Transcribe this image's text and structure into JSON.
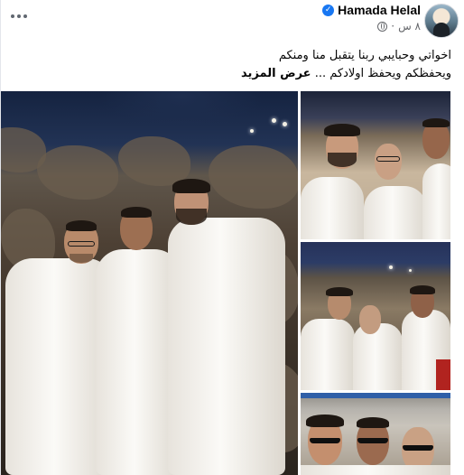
{
  "post": {
    "author": {
      "name": "Hamada Helal",
      "verified": true,
      "avatar_icon": "profile-avatar"
    },
    "meta": {
      "time": "٨ س",
      "audience_icon": "globe-icon"
    },
    "caption": {
      "line1": "اخواتي وحبايبي ربنا يتقبل منا ومنكم",
      "line2": "ويحفظكم ويحفظ اولادكم ...",
      "see_more": "عرض المزيد"
    },
    "menu_icon": "more-options-icon",
    "photos": [
      {
        "slot": "main",
        "description_icon": "photo-three-men-ihram-mountain"
      },
      {
        "slot": "top-right",
        "description_icon": "photo-three-men-closeup"
      },
      {
        "slot": "middle-right",
        "description_icon": "photo-group-mountain"
      },
      {
        "slot": "bottom-right",
        "description_icon": "photo-three-men-sunglasses"
      }
    ]
  },
  "colors": {
    "verified_blue": "#1877f2",
    "text_primary": "#050505",
    "text_secondary": "#65676b"
  }
}
